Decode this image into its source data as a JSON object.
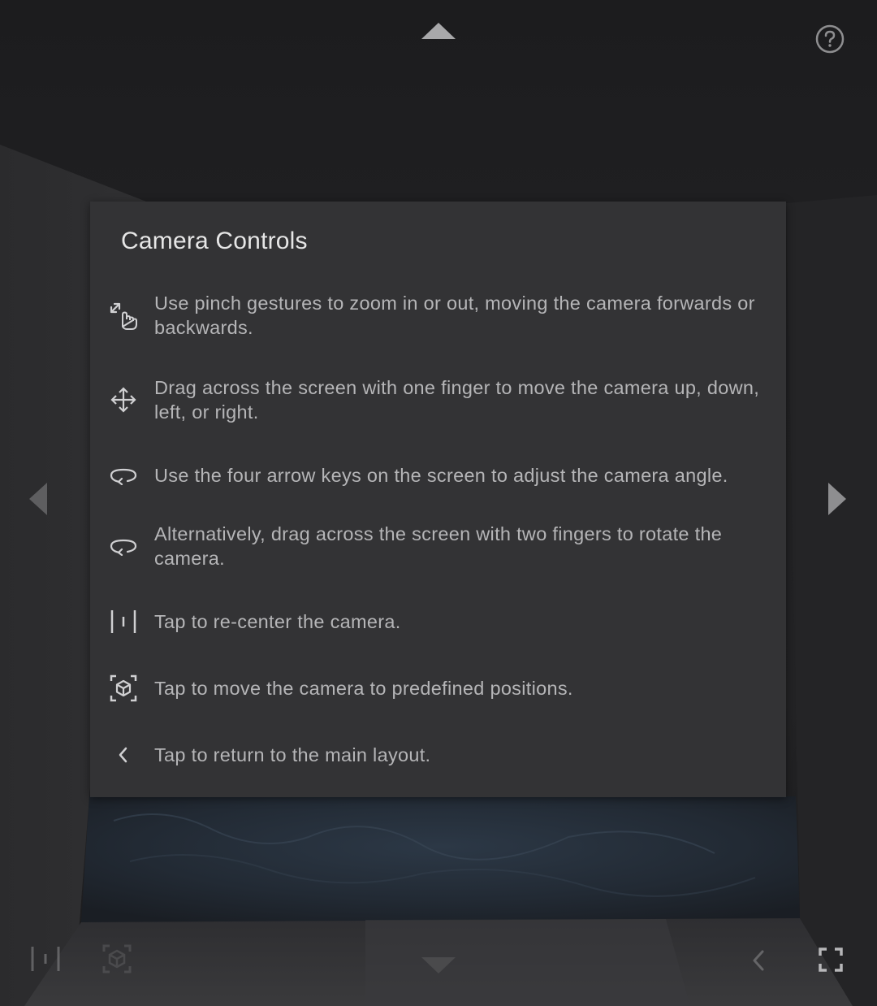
{
  "overlay": {
    "title": "Camera Controls",
    "items": [
      {
        "icon": "pinch-zoom-icon",
        "text": "Use pinch gestures to zoom in or out, moving the camera forwards or backwards."
      },
      {
        "icon": "move-arrows-icon",
        "text": "Drag across the screen with one finger to move the camera up, down, left, or right."
      },
      {
        "icon": "rotate-icon",
        "text": "Use the four arrow keys on the screen to adjust the camera angle."
      },
      {
        "icon": "rotate-icon",
        "text": "Alternatively, drag across the screen with two fingers to rotate the camera."
      },
      {
        "icon": "recenter-icon",
        "text": "Tap to re-center the camera."
      },
      {
        "icon": "cube-focus-icon",
        "text": "Tap to move the camera to predefined positions."
      },
      {
        "icon": "chevron-left-icon",
        "text": "Tap to return to the main layout."
      }
    ]
  },
  "controls": {
    "help_icon": "question-circle-icon",
    "arrows": [
      "caret-up-icon",
      "caret-down-icon",
      "caret-left-icon",
      "caret-right-icon"
    ],
    "bottom_left": [
      "recenter-icon",
      "cube-focus-icon"
    ],
    "bottom_right": [
      "chevron-left-icon",
      "fullscreen-icon"
    ]
  },
  "colors": {
    "overlay_bg": "#343436",
    "title": "#e6e6e6",
    "text": "#b5b5b7",
    "icon": "#d0d0d2",
    "arrow": "#a8a8aa"
  }
}
